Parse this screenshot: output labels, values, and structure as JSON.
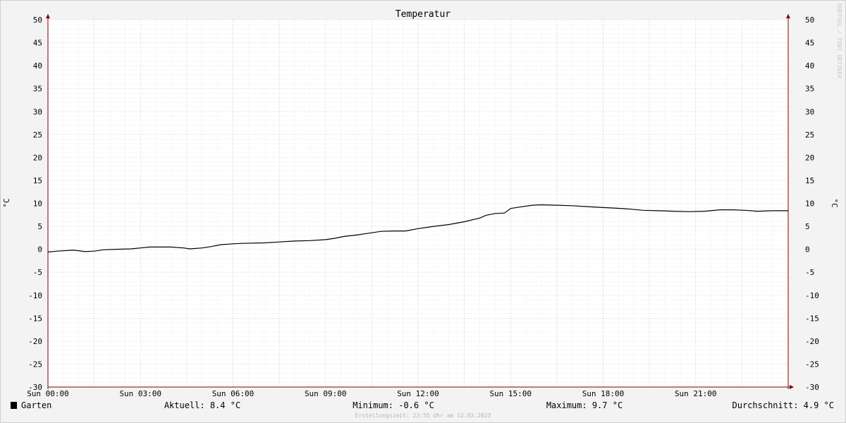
{
  "chart_data": {
    "type": "line",
    "title": "Temperatur",
    "ylabel": "°C",
    "ylim": [
      -30,
      50
    ],
    "yticks": [
      50,
      45,
      40,
      35,
      30,
      25,
      20,
      15,
      10,
      5,
      0,
      -5,
      -10,
      -15,
      -20,
      -25,
      -30
    ],
    "xlim": [
      0,
      24
    ],
    "xticks": [
      {
        "x": 0,
        "label": "Sun 00:00"
      },
      {
        "x": 3,
        "label": "Sun 03:00"
      },
      {
        "x": 6,
        "label": "Sun 06:00"
      },
      {
        "x": 9,
        "label": "Sun 09:00"
      },
      {
        "x": 12,
        "label": "Sun 12:00"
      },
      {
        "x": 15,
        "label": "Sun 15:00"
      },
      {
        "x": 18,
        "label": "Sun 18:00"
      },
      {
        "x": 21,
        "label": "Sun 21:00"
      }
    ],
    "grid": true,
    "legend_position": "bottom-left",
    "series": [
      {
        "name": "Garten",
        "color": "#000000",
        "x": [
          0,
          0.3,
          0.8,
          1.0,
          1.2,
          1.5,
          1.8,
          2.2,
          2.7,
          3.0,
          3.3,
          3.6,
          4.0,
          4.4,
          4.6,
          5.0,
          5.3,
          5.6,
          6.0,
          6.3,
          7.0,
          7.5,
          8.0,
          8.5,
          9.0,
          9.3,
          9.6,
          10.0,
          10.4,
          10.8,
          11.2,
          11.6,
          12.0,
          12.5,
          13.0,
          13.5,
          14.0,
          14.2,
          14.5,
          14.8,
          15.0,
          15.3,
          15.7,
          16.0,
          16.5,
          17.0,
          17.5,
          18.0,
          18.3,
          18.8,
          19.3,
          19.8,
          20.3,
          20.8,
          21.3,
          21.8,
          22.2,
          22.6,
          23.0,
          23.5,
          24.0
        ],
        "y": [
          -0.6,
          -0.4,
          -0.2,
          -0.3,
          -0.5,
          -0.4,
          -0.1,
          0.0,
          0.1,
          0.3,
          0.5,
          0.5,
          0.5,
          0.3,
          0.1,
          0.3,
          0.6,
          1.0,
          1.2,
          1.3,
          1.4,
          1.6,
          1.8,
          1.9,
          2.1,
          2.4,
          2.8,
          3.1,
          3.5,
          3.9,
          4.0,
          4.0,
          4.5,
          5.0,
          5.4,
          6.0,
          6.8,
          7.4,
          7.8,
          7.9,
          8.9,
          9.2,
          9.6,
          9.7,
          9.6,
          9.5,
          9.3,
          9.1,
          9.0,
          8.8,
          8.5,
          8.4,
          8.3,
          8.2,
          8.3,
          8.6,
          8.6,
          8.5,
          8.3,
          8.4,
          8.4
        ]
      }
    ]
  },
  "footer": {
    "current": "Aktuell: 8.4 °C",
    "minimum": "Minimum: -0.6 °C",
    "maximum": "Maximum: 9.7 °C",
    "average": "Durchschnitt: 4.9 °C",
    "created": "Erstellungszeit: 23:55 Uhr am 12.03.2023"
  },
  "watermark": "RRDTOOL / TOBI OETIKER",
  "colors": {
    "background": "#f3f3f3",
    "plot_background": "#ffffff",
    "major_grid": "#f0a0a0",
    "minor_grid": "#d6d6d6",
    "axis": "#800000",
    "line": "#000000"
  }
}
